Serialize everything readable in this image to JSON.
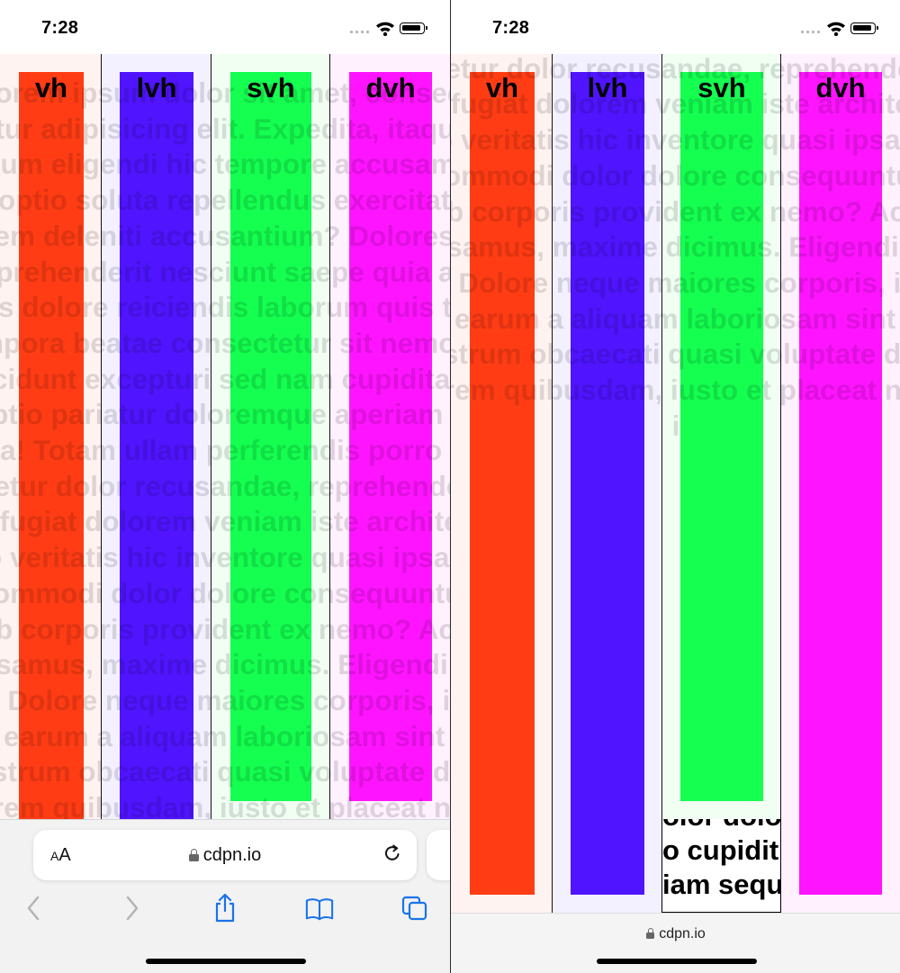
{
  "status": {
    "time": "7:28"
  },
  "browser": {
    "url": "cdpn.io",
    "text_size_label_small": "A",
    "text_size_label_large": "A"
  },
  "columns": [
    {
      "label": "vh",
      "color": "#ff3c14",
      "tint": "#fff3f1"
    },
    {
      "label": "lvh",
      "color": "#5014ff",
      "tint": "#f3f1ff"
    },
    {
      "label": "svh",
      "color": "#14ff50",
      "tint": "#f1fff3"
    },
    {
      "label": "dvh",
      "color": "#ff14ff",
      "tint": "#fff1fe"
    }
  ],
  "background_text": "Lorem ipsum dolor sit amet, consectetur adipisicing elit. Expedita, itaque illum eligendi hic tempore accusamus optio soluta repellendus exercitationem deleniti accusantium? Dolores reprehenderit nesciunt saepe quia alias dolore reiciendis laborum quis tempora beatae consectetur sit nemo incidunt excepturi sed nam cupiditate optio pariatur doloremque aperiam dicta! Totam ullam perferendis porro tenetur dolor recusandae, reprehenderit fugiat dolorem veniam iste architecto veritatis hic inventore quasi ipsam commodi dolor dolore consequuntur ab corporis provident ex nemo? Accusamus, maxime dicimus. Eligendi, id. Dolore neque maiores corporis, iste earum a aliquam laboriosam sint nostrum obcaecati quasi voluptate dolorem quibusdam, iusto et placeat nisi",
  "overflow_text": [
    "olor dolo",
    "o cupiditi",
    "iam sequ"
  ]
}
